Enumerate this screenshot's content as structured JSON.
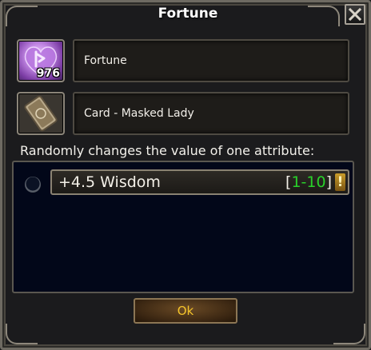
{
  "dialog": {
    "title": "Fortune",
    "close_icon": "close-icon"
  },
  "items": [
    {
      "name": "Fortune",
      "count": "976",
      "icon": "heart-rune-icon"
    },
    {
      "name": "Card - Masked Lady",
      "icon": "masked-lady-card-icon"
    }
  ],
  "description": "Randomly changes the value of one attribute:",
  "options": [
    {
      "label": "+4.5 Wisdom",
      "range_open": "[",
      "range": "1-10",
      "range_close": "]",
      "range_color": "#29d12a",
      "warning_icon": "exclamation-icon",
      "warning_symbol": "!",
      "selected": false
    }
  ],
  "buttons": {
    "ok_label": "Ok"
  },
  "colors": {
    "accent_gold": "#f5c42a",
    "range_green": "#29d12a",
    "panel_navy": "#020719"
  }
}
